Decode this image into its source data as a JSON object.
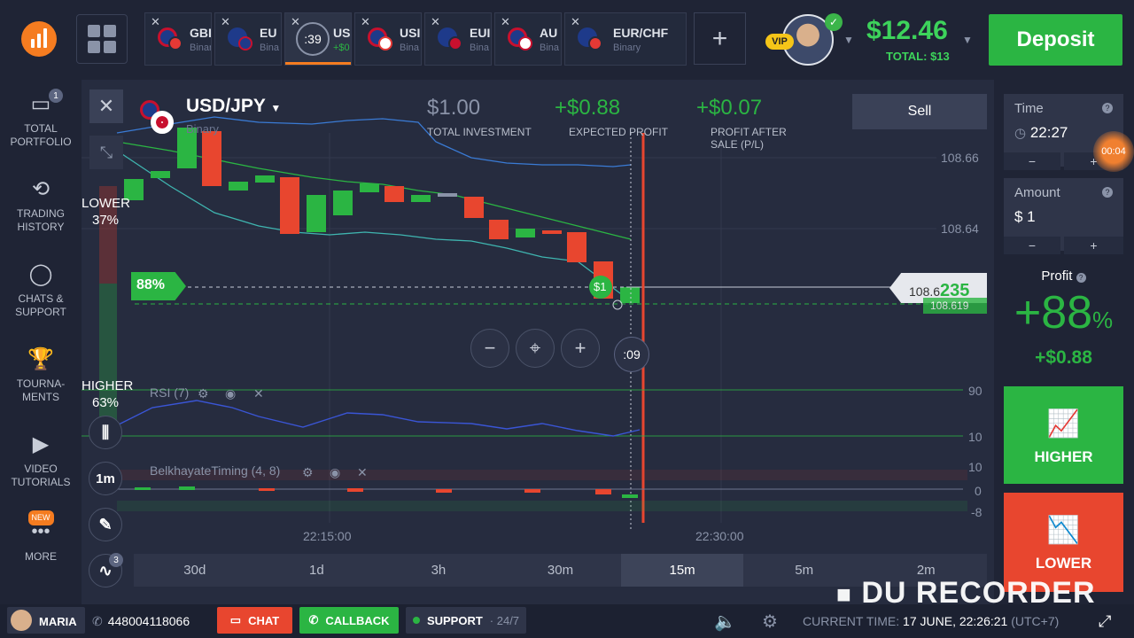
{
  "topbar": {
    "tabs": [
      {
        "name": "GBI",
        "sub": "Binar"
      },
      {
        "name": "EU",
        "sub": "Bina"
      },
      {
        "name": "USI",
        "sub": "+$0",
        "timer": ":39"
      },
      {
        "name": "USI",
        "sub": "Bina"
      },
      {
        "name": "EUI",
        "sub": "Bina"
      },
      {
        "name": "AU",
        "sub": "Bina"
      },
      {
        "name": "EUR/CHF",
        "sub": "Binary"
      }
    ],
    "vip": "VIP",
    "balance": "$12.46",
    "total": "TOTAL: $13",
    "deposit": "Deposit"
  },
  "sidebar": {
    "items": [
      {
        "label": "TOTAL PORTFOLIO",
        "badge": "1"
      },
      {
        "label": "TRADING HISTORY"
      },
      {
        "label": "CHATS & SUPPORT"
      },
      {
        "label": "TOURNA- MENTS"
      },
      {
        "label": "VIDEO TUTORIALS"
      },
      {
        "label": "MORE",
        "badge": "NEW"
      }
    ]
  },
  "asset": {
    "pair": "USD/JPY",
    "type": "Binary"
  },
  "stats": {
    "investment": {
      "value": "$1.00",
      "label": "TOTAL INVESTMENT"
    },
    "expected": {
      "value": "+$0.88",
      "label": "EXPECTED PROFIT"
    },
    "after_sale": {
      "value": "+$0.07",
      "label": "PROFIT AFTER SALE (P/L)"
    },
    "sell": "Sell"
  },
  "sentiment": {
    "lower_label": "LOWER",
    "lower_pct": "37%",
    "higher_label": "HIGHER",
    "higher_pct": "63%"
  },
  "chart": {
    "payout_pill": "88%",
    "price_prefix": "108.6",
    "price_suffix": "235",
    "price_secondary": "108.619",
    "deal_marker": "$1",
    "countdown": ":09",
    "timeframe": "1m",
    "tools_badge": "3",
    "rsi_label": "RSI (7)",
    "bt_label": "BelkhayateTiming (4, 8)",
    "y_ticks": [
      "108.66",
      "108.64"
    ],
    "rsi_ticks": [
      "90",
      "10"
    ],
    "bt_ticks": [
      "10",
      "0",
      "-8"
    ],
    "x_ticks": [
      "22:15:00",
      "22:30:00"
    ]
  },
  "chart_data": {
    "type": "candlestick",
    "x": [
      "22:15:00",
      "22:30:00"
    ],
    "y_ticks": [
      108.64,
      108.66
    ],
    "current_price": 108.6235,
    "indicators": [
      "RSI (7)",
      "BelkhayateTiming (4, 8)"
    ]
  },
  "timebar": [
    "30d",
    "1d",
    "3h",
    "30m",
    "15m",
    "5m",
    "2m"
  ],
  "timebar_selected": "15m",
  "right": {
    "time_label": "Time",
    "time_value": "22:27",
    "time_remaining": "00:04",
    "amount_label": "Amount",
    "amount_value": "$  1",
    "profit_label": "Profit",
    "profit_pct": "+88",
    "pct_sign": "%",
    "profit_amt": "+$0.88",
    "higher": "HIGHER",
    "lower": "LOWER"
  },
  "bottombar": {
    "user": "MARIA",
    "phone": "448004118066",
    "chat": "CHAT",
    "callback": "CALLBACK",
    "support": "SUPPORT",
    "support_hours": "· 24/7",
    "current_time": "CURRENT TIME:",
    "current_time_value": "17 JUNE, 22:26:21",
    "tz": "(UTC+7)"
  },
  "watermark": "DU RECORDER",
  "colors": {
    "green": "#2bb543",
    "red": "#e8462f",
    "accent_orange": "#f57c20",
    "bg": "#252b3d"
  }
}
